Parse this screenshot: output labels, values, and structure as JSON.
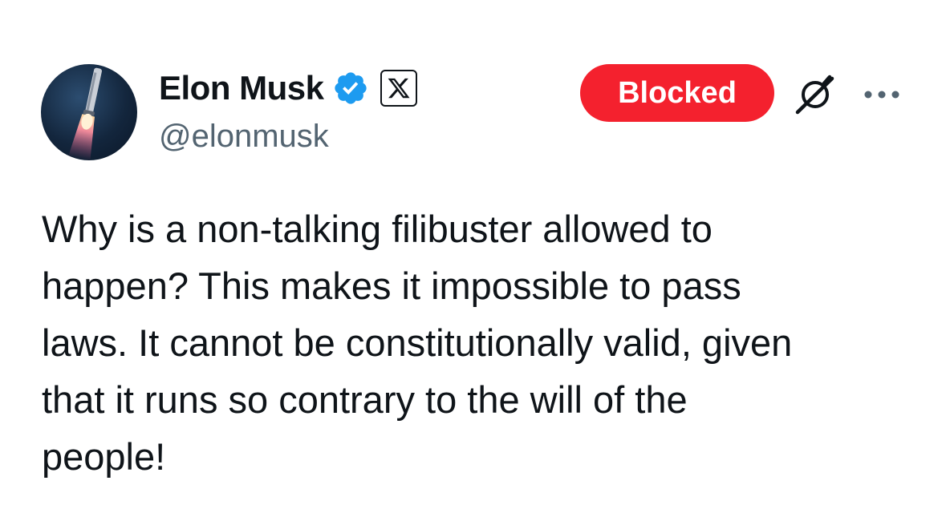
{
  "author": {
    "display_name": "Elon Musk",
    "handle": "@elonmusk",
    "avatar_icon": "rocket-launch-avatar",
    "verified_icon": "verified-badge-icon",
    "affiliate_icon": "x-logo-icon"
  },
  "actions": {
    "blocked_label": "Blocked",
    "grok_icon": "grok-slash-icon",
    "more_icon": "more-options-icon"
  },
  "tweet": {
    "text": "Why is a non-talking filibuster allowed to\nhappen? This makes it impossible to pass\nlaws. It cannot be constitutionally valid, given\nthat it runs so contrary to the will of the\npeople!"
  },
  "colors": {
    "blocked_bg": "#f4212e",
    "verified_blue": "#1d9bf0",
    "handle_gray": "#536471",
    "text_dark": "#0f1419"
  }
}
